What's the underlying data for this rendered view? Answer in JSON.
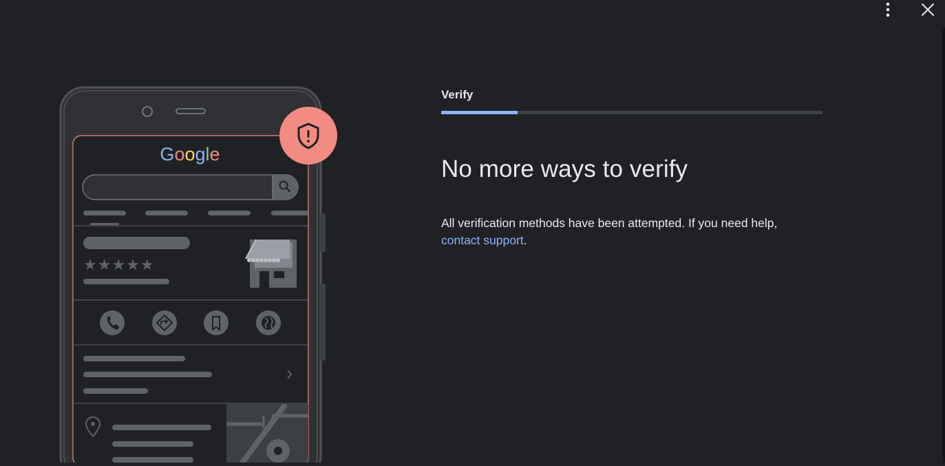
{
  "toolbar": {
    "more_icon": "more-vert-icon",
    "close_icon": "close-icon"
  },
  "illustration": {
    "logo_text": "Google",
    "logo_colors": [
      "#8ab4f8",
      "#f28b82",
      "#fdd663",
      "#8ab4f8",
      "#81c995",
      "#f28b82"
    ],
    "alert_badge_color": "#f28b82",
    "alert_icon": "shield-alert-icon",
    "rating_stars": "★★★★★",
    "action_icons": [
      "phone-icon",
      "directions-icon",
      "bookmark-icon",
      "globe-icon"
    ]
  },
  "step": {
    "label": "Verify",
    "progress": 0.2
  },
  "main": {
    "title": "No more ways to verify",
    "body_before_link": "All verification methods have been attempted. If you need help, ",
    "link_text": "contact support",
    "body_after_link": "."
  },
  "colors": {
    "background": "#202124",
    "accent": "#8ab4f8",
    "text": "#e8eaed"
  }
}
